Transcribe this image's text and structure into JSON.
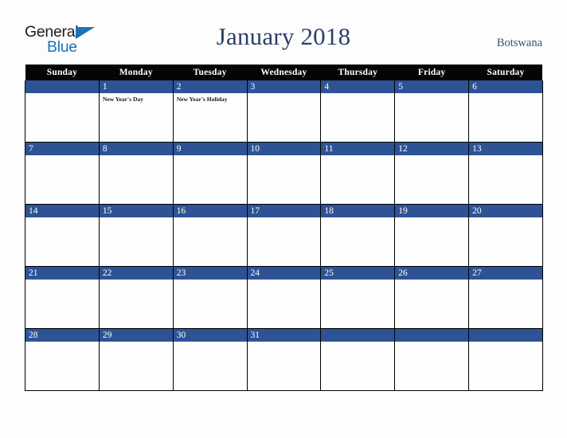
{
  "brand": {
    "name_line1": "General",
    "name_line2": "Blue",
    "triangle_icon": "triangle-icon",
    "color_dark": "#1c1c1c",
    "color_blue": "#1a72ba"
  },
  "header": {
    "title": "January 2018",
    "country": "Botswana",
    "title_color": "#2c4069"
  },
  "calendar": {
    "weekday_headers": [
      "Sunday",
      "Monday",
      "Tuesday",
      "Wednesday",
      "Thursday",
      "Friday",
      "Saturday"
    ],
    "header_bg": "#050505",
    "daynum_bg": "#2e5395",
    "weeks": [
      [
        {
          "day": "",
          "events": []
        },
        {
          "day": "1",
          "events": [
            "New Year's Day"
          ]
        },
        {
          "day": "2",
          "events": [
            "New Year's Holiday"
          ]
        },
        {
          "day": "3",
          "events": []
        },
        {
          "day": "4",
          "events": []
        },
        {
          "day": "5",
          "events": []
        },
        {
          "day": "6",
          "events": []
        }
      ],
      [
        {
          "day": "7",
          "events": []
        },
        {
          "day": "8",
          "events": []
        },
        {
          "day": "9",
          "events": []
        },
        {
          "day": "10",
          "events": []
        },
        {
          "day": "11",
          "events": []
        },
        {
          "day": "12",
          "events": []
        },
        {
          "day": "13",
          "events": []
        }
      ],
      [
        {
          "day": "14",
          "events": []
        },
        {
          "day": "15",
          "events": []
        },
        {
          "day": "16",
          "events": []
        },
        {
          "day": "17",
          "events": []
        },
        {
          "day": "18",
          "events": []
        },
        {
          "day": "19",
          "events": []
        },
        {
          "day": "20",
          "events": []
        }
      ],
      [
        {
          "day": "21",
          "events": []
        },
        {
          "day": "22",
          "events": []
        },
        {
          "day": "23",
          "events": []
        },
        {
          "day": "24",
          "events": []
        },
        {
          "day": "25",
          "events": []
        },
        {
          "day": "26",
          "events": []
        },
        {
          "day": "27",
          "events": []
        }
      ],
      [
        {
          "day": "28",
          "events": []
        },
        {
          "day": "29",
          "events": []
        },
        {
          "day": "30",
          "events": []
        },
        {
          "day": "31",
          "events": []
        },
        {
          "day": "",
          "events": []
        },
        {
          "day": "",
          "events": []
        },
        {
          "day": "",
          "events": []
        }
      ]
    ]
  }
}
